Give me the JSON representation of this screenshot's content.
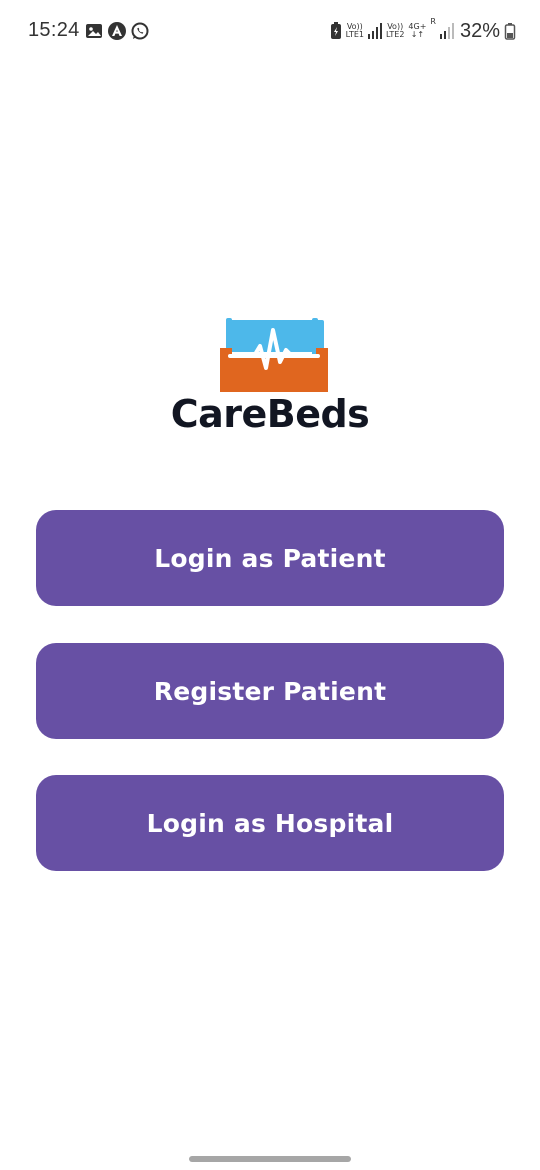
{
  "status_bar": {
    "time": "15:24",
    "left_icons": [
      "image-icon",
      "a-circle-icon",
      "whatsapp-icon"
    ],
    "sim1_top": "Vo))",
    "sim1_bottom": "LTE1",
    "sim2_top": "Vo))",
    "sim2_bottom": "LTE2",
    "network_type": "4G+",
    "roaming": "R",
    "battery_percent": "32%"
  },
  "logo": {
    "name": "CareBeds",
    "colors": {
      "pillow": "#4db8ea",
      "bed": "#e0661f",
      "pulse": "#ffffff",
      "text": "#121622"
    }
  },
  "buttons": {
    "login_patient": "Login as Patient",
    "register_patient": "Register Patient",
    "login_hospital": "Login as Hospital"
  },
  "theme": {
    "button_color": "#6750a4",
    "button_text_color": "#ffffff"
  }
}
